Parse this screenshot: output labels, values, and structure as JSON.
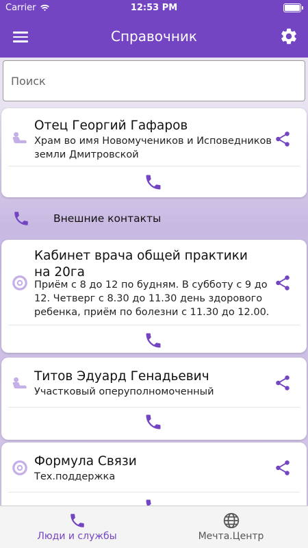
{
  "status_bar": {
    "carrier": "Carrier",
    "time": "12:53 PM"
  },
  "app_bar": {
    "title": "Справочник"
  },
  "search": {
    "placeholder": "Поиск",
    "value": ""
  },
  "contacts": [
    {
      "title": "Отец Георгий Гафаров",
      "subtitle": "Храм во имя Новомучеников и Исповедников земли Дмитровской",
      "icon": "person-icon"
    },
    {
      "title": "Кабинет врача общей практики на 20га",
      "subtitle": "Приём с 8 до 12 по будням. В субботу с 9 до 12. Четверг с 8.30 до 11.30 день здорового ребенка, приём по болезни с 11.30 до 12.00.",
      "icon": "lifebuoy-icon"
    },
    {
      "title": "Титов Эдуард Генадьевич",
      "subtitle": "Участковый оперуполномоченный",
      "icon": "person-icon"
    },
    {
      "title": "Формула Связи",
      "subtitle": "Тех.поддержка",
      "icon": "lifebuoy-icon"
    }
  ],
  "section": {
    "label": "Внешние контакты"
  },
  "tabs": [
    {
      "label": "Люди и службы",
      "icon": "phone-icon",
      "active": true
    },
    {
      "label": "Мечта.Центр",
      "icon": "globe-icon",
      "active": false
    }
  ],
  "colors": {
    "primary": "#7445c3",
    "icon_light": "#c4b0e6",
    "tab_inactive": "#555555"
  }
}
